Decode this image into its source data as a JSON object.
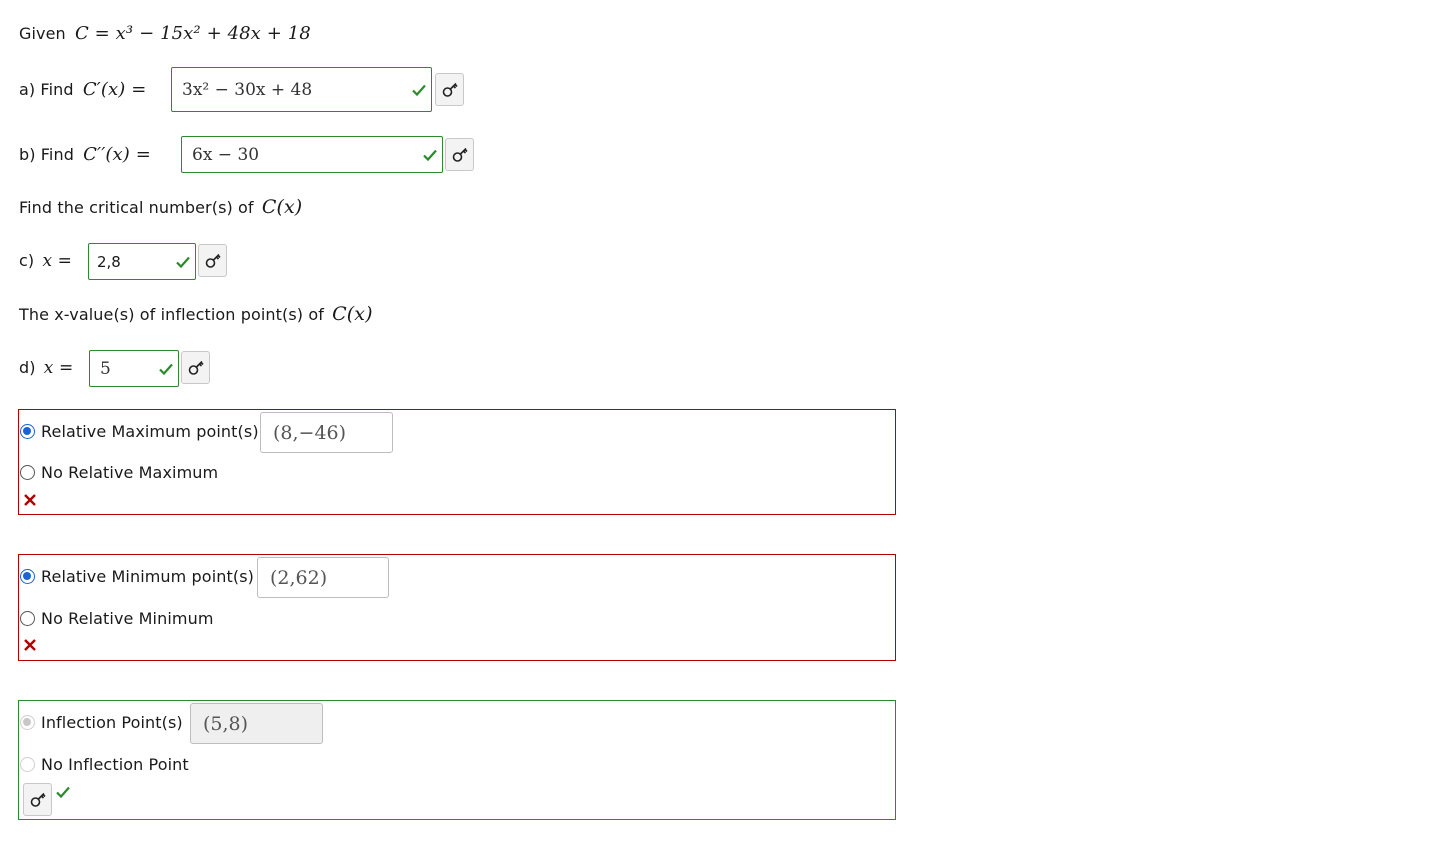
{
  "given": {
    "prefix": "Given",
    "expr": "C = x³ − 15x² + 48x + 18"
  },
  "part_a": {
    "label": "a) Find",
    "expr": "C′(x) =",
    "answer": "3x² − 30x + 48",
    "status": "correct"
  },
  "part_b": {
    "label": "b) Find",
    "expr": "C′′(x) =",
    "answer": "6x − 30",
    "status": "correct"
  },
  "critical_prompt": {
    "text": "Find the critical number(s) of",
    "expr": "C(x)"
  },
  "part_c": {
    "label": "c)",
    "expr": "x =",
    "answer": "2,8",
    "status": "correct"
  },
  "inflection_prompt": {
    "text": "The x-value(s) of inflection point(s) of",
    "expr": "C(x)"
  },
  "part_d": {
    "label": "d)",
    "expr": "x =",
    "answer": "5",
    "status": "correct"
  },
  "rel_max": {
    "option_points": "Relative Maximum point(s)",
    "option_none": "No Relative Maximum",
    "selected": "points",
    "value": "(8,−46)",
    "status": "incorrect"
  },
  "rel_min": {
    "option_points": "Relative Minimum point(s)",
    "option_none": "No Relative Minimum",
    "selected": "points",
    "value": "(2,62)",
    "status": "incorrect"
  },
  "inflection": {
    "option_points": "Inflection Point(s)",
    "option_none": "No Inflection Point",
    "selected": "points",
    "value": "(5,8)",
    "status": "correct",
    "disabled": true
  },
  "colors": {
    "correct": "#2b8a2b",
    "incorrect": "#b30000",
    "radio_selected": "#1a62d6"
  },
  "icons": {
    "check": "check-icon",
    "cross": "x-mark-icon",
    "key": "key-icon"
  }
}
